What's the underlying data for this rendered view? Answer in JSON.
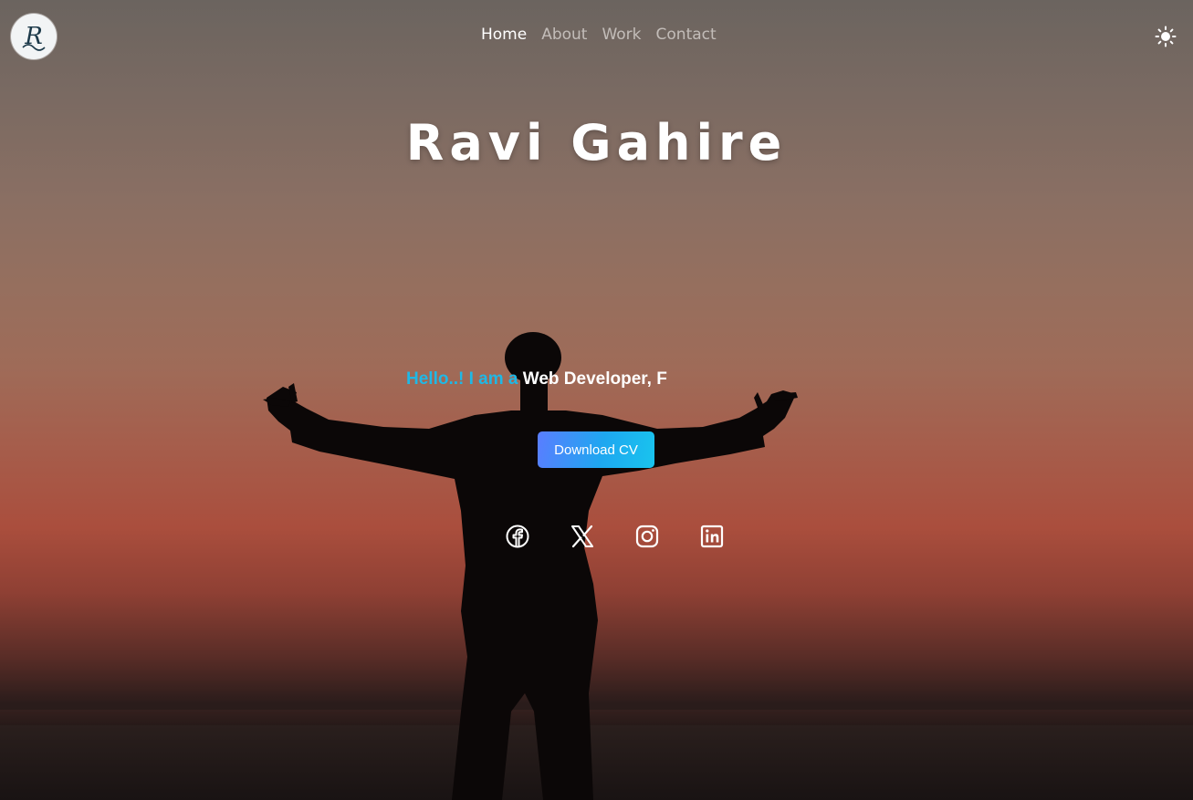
{
  "nav": {
    "logo_letter": "R",
    "items": [
      {
        "label": "Home",
        "active": true
      },
      {
        "label": "About",
        "active": false
      },
      {
        "label": "Work",
        "active": false
      },
      {
        "label": "Contact",
        "active": false
      }
    ],
    "theme_icon": "sun-icon"
  },
  "hero": {
    "name": "Ravi Gahire",
    "greeting": "Hello..! I am a",
    "role_typed": "Web Developer, F",
    "cv_button": "Download CV"
  },
  "socials": [
    {
      "icon": "facebook-icon"
    },
    {
      "icon": "x-twitter-icon"
    },
    {
      "icon": "instagram-icon"
    },
    {
      "icon": "linkedin-icon"
    }
  ],
  "colors": {
    "greeting": "#1fb8e6",
    "button_start": "#5a7dff",
    "button_end": "#19c4ee",
    "text": "#ffffff"
  }
}
